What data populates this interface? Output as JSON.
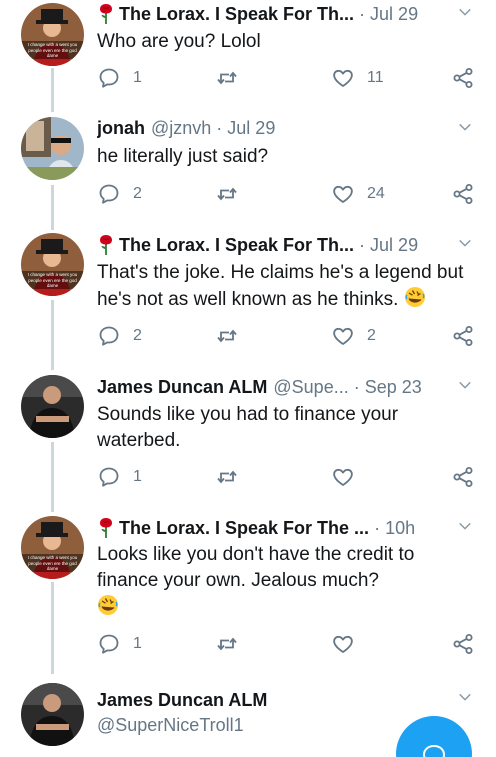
{
  "tweets": [
    {
      "name": "The Lorax. I Speak For Th...",
      "handle": "",
      "date": "Jul 29",
      "text": "Who are you? Lolol",
      "replies": "1",
      "retweets": "",
      "likes": "11",
      "avatar": "lorax",
      "has_rose": true
    },
    {
      "name": "jonah",
      "handle": "@jznvh",
      "date": "Jul 29",
      "text": "he literally just said?",
      "replies": "2",
      "retweets": "",
      "likes": "24",
      "avatar": "jonah",
      "has_rose": false
    },
    {
      "name": "The Lorax. I Speak For Th...",
      "handle": "",
      "date": "Jul 29",
      "text": "That's the joke. He claims he's a legend but he's not as well known as he thinks.",
      "replies": "2",
      "retweets": "",
      "likes": "2",
      "avatar": "lorax",
      "has_rose": true,
      "emoji": "rolling-on-floor-laughing"
    },
    {
      "name": "James Duncan ALM",
      "handle": "@Supe...",
      "date": "Sep 23",
      "text": "Sounds like you had to finance your waterbed.",
      "replies": "1",
      "retweets": "",
      "likes": "",
      "avatar": "james",
      "has_rose": false
    },
    {
      "name": "The Lorax. I Speak For The ...",
      "handle": "",
      "date": "10h",
      "text": "Looks like you don't have the credit to finance your own. Jealous much?",
      "replies": "1",
      "retweets": "",
      "likes": "",
      "avatar": "lorax",
      "has_rose": true,
      "emoji": "rolling-on-floor-laughing"
    },
    {
      "name": "James Duncan ALM",
      "handle": "@SuperNiceTroll1",
      "avatar": "james"
    }
  ],
  "lorax_avatar_caption": "I change with a went you people even ere the god dame",
  "colors": {
    "accent": "#1da1f2",
    "muted": "#657786",
    "thread": "#ccd6dd",
    "rose": "#d0021b"
  },
  "icons": [
    "reply-icon",
    "retweet-icon",
    "like-icon",
    "share-icon",
    "chevron-down-icon",
    "compose-icon",
    "rose-emoji-icon",
    "rofl-emoji-icon"
  ]
}
